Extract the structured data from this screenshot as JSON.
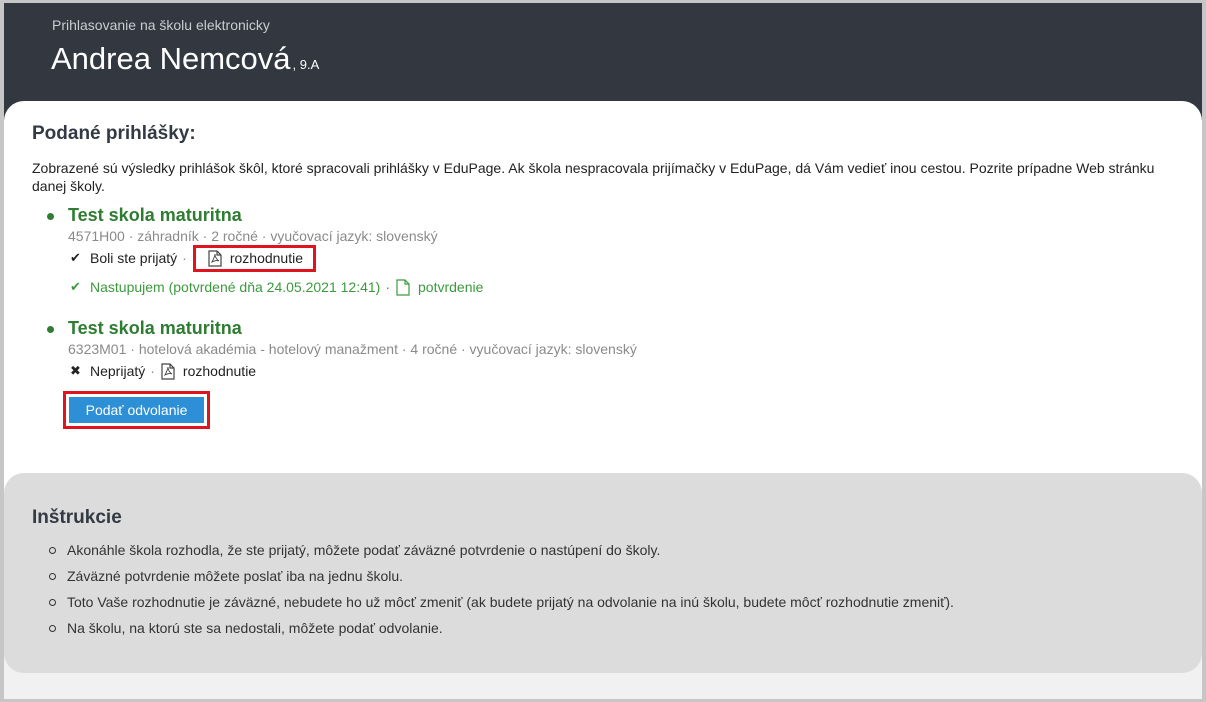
{
  "header": {
    "subtitle": "Prihlasovanie na školu elektronicky",
    "student_name": "Andrea Nemcová",
    "class": ", 9.A"
  },
  "applications_section": {
    "title": "Podané prihlášky:",
    "intro": "Zobrazené sú výsledky prihlášok škôl, ktoré spracovali prihlášky v EduPage. Ak škola nespracovala prijímačky v EduPage, dá Vám vedieť inou cestou. Pozrite prípadne Web stránku danej školy.",
    "applications": [
      {
        "school": "Test skola maturitna",
        "meta": "4571H00 · záhradník · 2 ročné · vyučovací jazyk: slovenský",
        "status_icon": "check-icon",
        "status": "Boli ste prijatý",
        "decision_label": "rozhodnutie",
        "confirm_status": "Nastupujem (potvrdené dňa 24.05.2021 12:41)",
        "confirm_doc_label": "potvrdenie"
      },
      {
        "school": "Test skola maturitna",
        "meta": "6323M01 · hotelová akadémia - hotelový manažment · 4 ročné · vyučovací jazyk: slovenský",
        "status_icon": "cross-icon",
        "status": "Neprijatý",
        "decision_label": "rozhodnutie",
        "appeal_button": "Podať odvolanie"
      }
    ]
  },
  "instructions": {
    "title": "Inštrukcie",
    "items": [
      "Akonáhle škola rozhodla, že ste prijatý, môžete podať záväzné potvrdenie o nastúpení do školy.",
      "Záväzné potvrdenie môžete poslať iba na jednu školu.",
      "Toto Vaše rozhodnutie je záväzné, nebudete ho už môcť zmeniť (ak budete prijatý na odvolanie na inú školu, budete môcť rozhodnutie zmeniť).",
      "Na školu, na ktorú ste sa nedostali, môžete podať odvolanie."
    ]
  },
  "colors": {
    "header_bg": "#323740",
    "school_green": "#2f7d32",
    "confirm_green": "#3c9a3e",
    "button_blue": "#2d8fd5",
    "highlight_red": "#e0141e"
  }
}
